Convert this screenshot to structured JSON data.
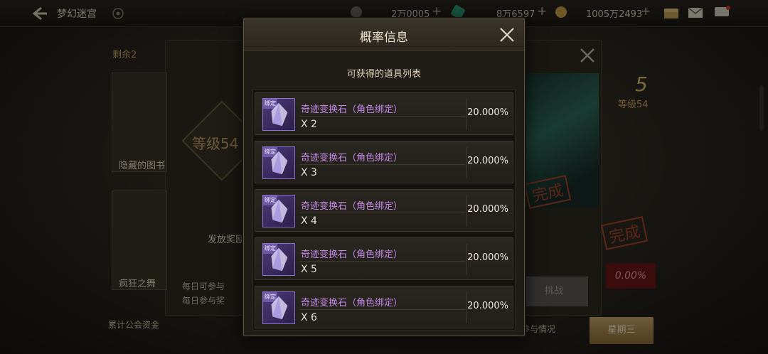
{
  "topbar": {
    "title": "梦幻迷宫",
    "currency1": "2万0005",
    "currency2": "8万6597",
    "currency3": "1005万2493",
    "plus": "+"
  },
  "background": {
    "remaining_label": "剩余2",
    "level_diamond": "等级54",
    "level_small": "等级54",
    "stage_number": "5",
    "card1_label": "隐藏的图书",
    "card2_label": "疯狂之舞",
    "reward_label": "发放奖励",
    "bullet1": "每日可参与",
    "bullet2": "每日参与奖",
    "guild_label": "累计公会资金",
    "status_label": "参与情况",
    "weekday_button": "星期三",
    "complete_stamp": "完成",
    "percent": "0.00%",
    "challenge_button": "挑战"
  },
  "modal": {
    "title": "概率信息",
    "subtitle": "可获得的道具列表",
    "bind_tag": "绑定",
    "items": [
      {
        "name": "奇迹变换石（角色绑定）",
        "qty": "X 2",
        "prob": "20.000%"
      },
      {
        "name": "奇迹变换石（角色绑定）",
        "qty": "X 3",
        "prob": "20.000%"
      },
      {
        "name": "奇迹变换石（角色绑定）",
        "qty": "X 4",
        "prob": "20.000%"
      },
      {
        "name": "奇迹变换石（角色绑定）",
        "qty": "X 5",
        "prob": "20.000%"
      },
      {
        "name": "奇迹变换石（角色绑定）",
        "qty": "X 6",
        "prob": "20.000%"
      }
    ]
  },
  "icons": [
    "back-arrow-icon",
    "eye-icon",
    "coin-icon",
    "gem-icon",
    "gold-icon",
    "chest-icon",
    "mail-icon",
    "chat-icon",
    "close-icon",
    "stone-icon"
  ],
  "colors": {
    "item_name": "#c58ae8",
    "accent_gold": "#c9a66a",
    "modal_bg": "#201d18"
  }
}
